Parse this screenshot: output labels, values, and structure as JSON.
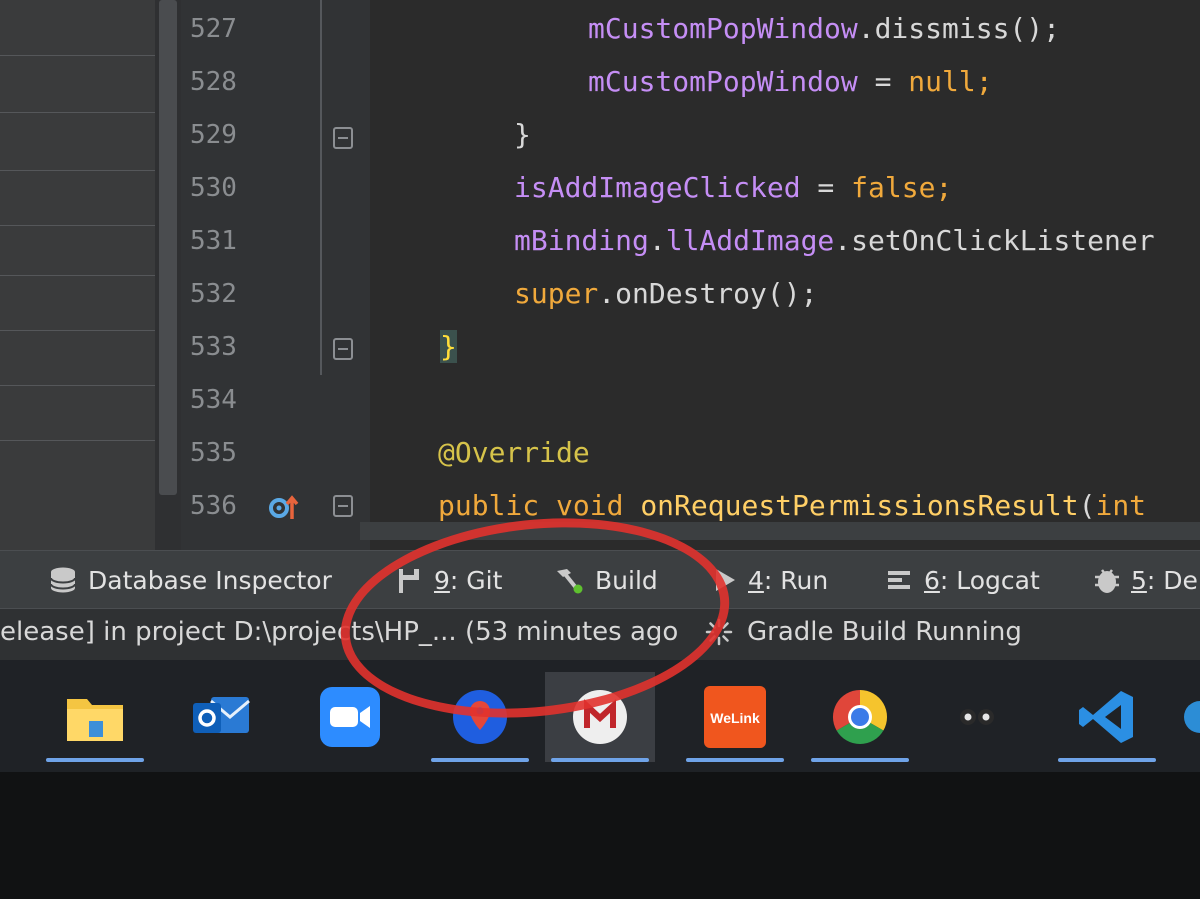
{
  "editor": {
    "lines": [
      {
        "num": "527",
        "tokens": [
          {
            "t": "mCustomPopWindow",
            "c": "field"
          },
          {
            "t": ".dissmiss();",
            "c": "plain"
          }
        ]
      },
      {
        "num": "528",
        "tokens": [
          {
            "t": "mCustomPopWindow",
            "c": "field"
          },
          {
            "t": " = ",
            "c": "plain"
          },
          {
            "t": "null",
            "c": "kw"
          },
          {
            "t": ";",
            "c": "kw"
          }
        ]
      },
      {
        "num": "529",
        "tokens": [
          {
            "t": "}",
            "c": "plain"
          }
        ]
      },
      {
        "num": "530",
        "tokens": [
          {
            "t": "isAddImageClicked",
            "c": "field"
          },
          {
            "t": " = ",
            "c": "plain"
          },
          {
            "t": "false",
            "c": "kw"
          },
          {
            "t": ";",
            "c": "kw"
          }
        ]
      },
      {
        "num": "531",
        "tokens": [
          {
            "t": "mBinding",
            "c": "field"
          },
          {
            "t": ".",
            "c": "plain"
          },
          {
            "t": "llAddImage",
            "c": "field"
          },
          {
            "t": ".setOnClickListener",
            "c": "plain"
          }
        ]
      },
      {
        "num": "532",
        "tokens": [
          {
            "t": "super",
            "c": "kw"
          },
          {
            "t": ".onDestroy();",
            "c": "plain"
          }
        ]
      },
      {
        "num": "533",
        "tokens": [
          {
            "t": "}",
            "c": "brace-hl"
          }
        ]
      },
      {
        "num": "534",
        "tokens": []
      },
      {
        "num": "535",
        "tokens": [
          {
            "t": "@Override",
            "c": "anno"
          }
        ]
      },
      {
        "num": "536",
        "tokens": [
          {
            "t": "public",
            "c": "kw"
          },
          {
            "t": " ",
            "c": "plain"
          },
          {
            "t": "void",
            "c": "kw"
          },
          {
            "t": " ",
            "c": "plain"
          },
          {
            "t": "onRequestPermissionsResult",
            "c": "fn"
          },
          {
            "t": "(",
            "c": "plain"
          },
          {
            "t": "int",
            "c": "kw"
          }
        ]
      }
    ]
  },
  "tool_windows": [
    {
      "id": "database-inspector",
      "num": "",
      "label": "Database Inspector"
    },
    {
      "id": "git",
      "num": "9",
      "label": ": Git"
    },
    {
      "id": "build",
      "num": "",
      "label": "Build"
    },
    {
      "id": "run",
      "num": "4",
      "label": ": Run"
    },
    {
      "id": "logcat",
      "num": "6",
      "label": ": Logcat"
    },
    {
      "id": "debug",
      "num": "5",
      "label": ": Deb"
    }
  ],
  "status": {
    "left_text": "elease] in project D:\\projects\\HP_... (53 minutes ago",
    "right_text": "Gradle Build Running"
  },
  "taskbar": [
    {
      "icon": "file-explorer-icon",
      "active": false,
      "open": true
    },
    {
      "icon": "outlook-icon",
      "active": false,
      "open": false
    },
    {
      "icon": "zoom-icon",
      "active": false,
      "open": false
    },
    {
      "icon": "maps-pin-icon",
      "active": false,
      "open": true
    },
    {
      "icon": "app-m-icon",
      "active": true,
      "open": true
    },
    {
      "icon": "welink-icon",
      "active": false,
      "open": true,
      "text": "WeLink"
    },
    {
      "icon": "chrome-icon",
      "active": false,
      "open": true
    },
    {
      "icon": "dots-app-icon",
      "active": false,
      "open": false
    },
    {
      "icon": "vscode-icon",
      "active": false,
      "open": true
    },
    {
      "icon": "edge-partial-icon",
      "active": false,
      "open": true
    }
  ],
  "colors": {
    "annotation": "#e1322d",
    "taskbar_underline": "#6fa3e8",
    "field": "#c58ef5",
    "keyword": "#f0a93c"
  }
}
